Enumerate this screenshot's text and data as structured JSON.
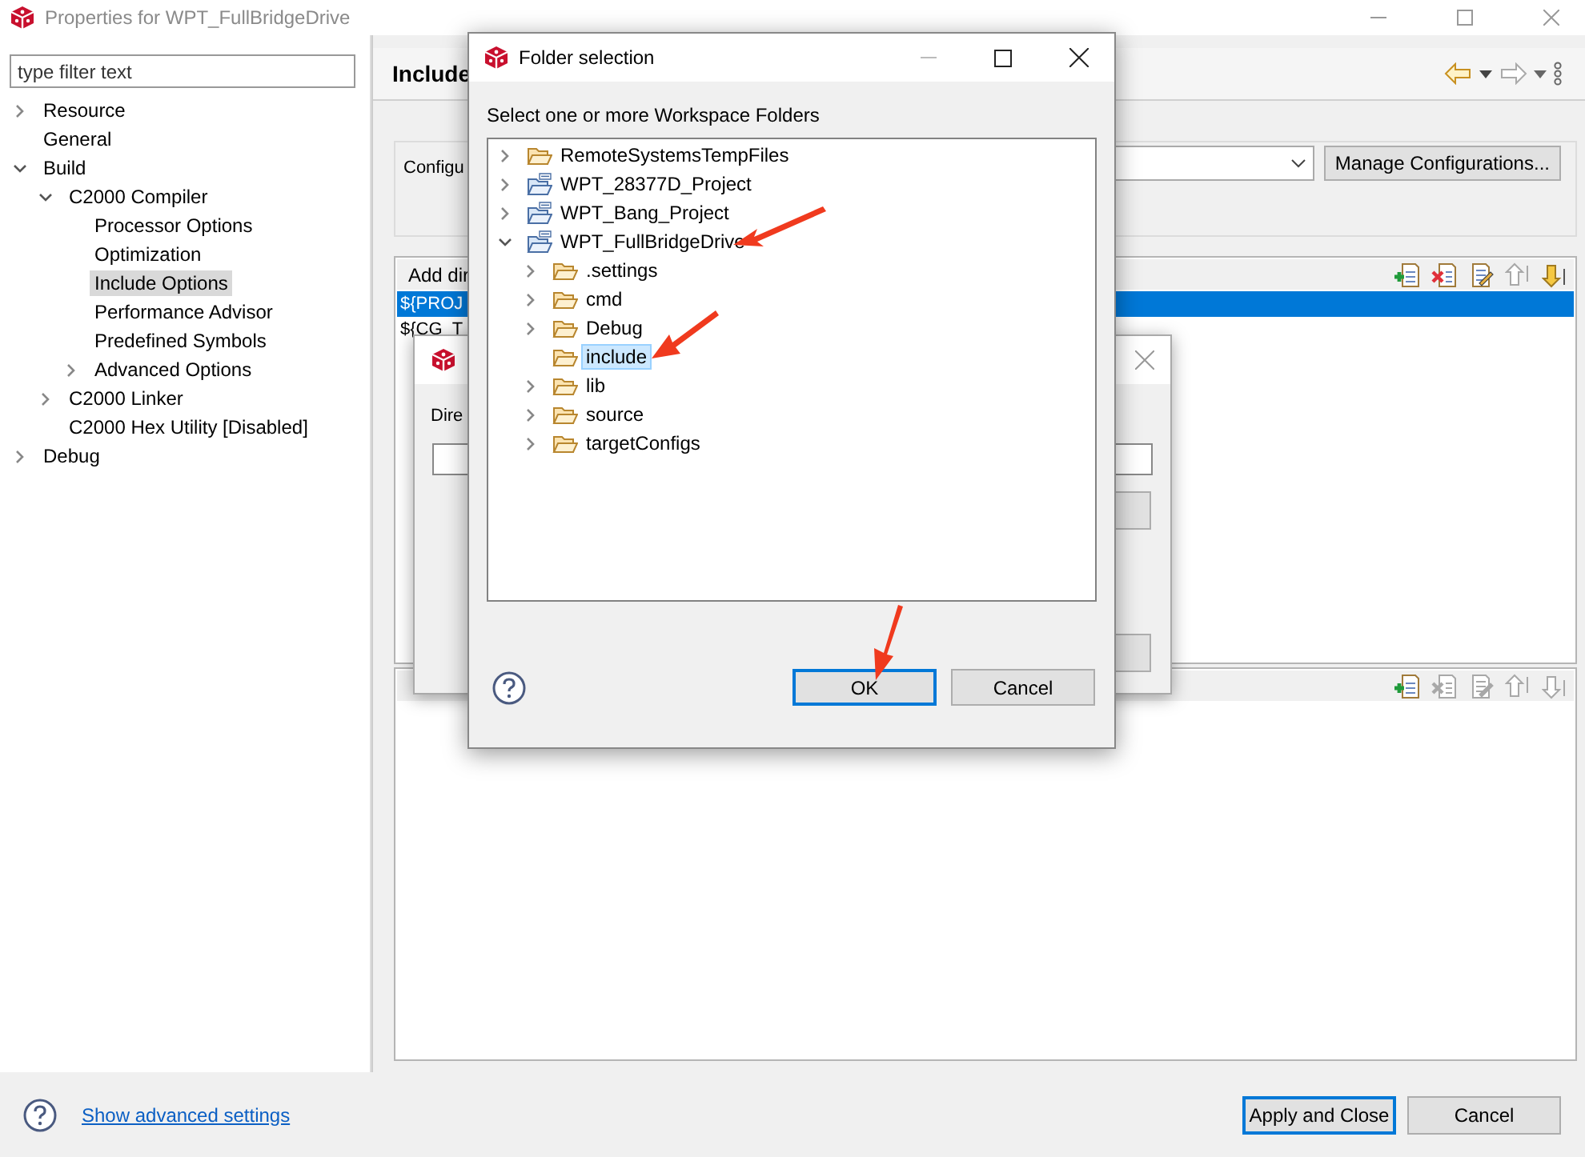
{
  "window": {
    "title": "Properties for WPT_FullBridgeDrive"
  },
  "sidebar": {
    "filter": {
      "placeholder": "type filter text"
    },
    "tree": [
      {
        "label": "Resource",
        "expanded": false,
        "selected": false
      },
      {
        "label": "General",
        "selected": false
      },
      {
        "label": "Build",
        "expanded": true,
        "selected": false,
        "children": [
          {
            "label": "C2000 Compiler",
            "expanded": true,
            "selected": false,
            "children": [
              {
                "label": "Processor Options",
                "selected": false
              },
              {
                "label": "Optimization",
                "selected": false
              },
              {
                "label": "Include Options",
                "selected": true
              },
              {
                "label": "Performance Advisor",
                "selected": false
              },
              {
                "label": "Predefined Symbols",
                "selected": false
              },
              {
                "label": "Advanced Options",
                "expanded": false,
                "selected": false
              }
            ]
          },
          {
            "label": "C2000 Linker",
            "expanded": false,
            "selected": false
          },
          {
            "label": "C2000 Hex Utility  [Disabled]",
            "selected": false
          }
        ]
      },
      {
        "label": "Debug",
        "expanded": false,
        "selected": false
      }
    ]
  },
  "page": {
    "title": "Include",
    "config_label": "Configu",
    "manage_button": "Manage Configurations...",
    "include_list": {
      "header": "Add dir",
      "tools": [
        {
          "kind": "add",
          "disabled": false
        },
        {
          "kind": "delete",
          "disabled": false
        },
        {
          "kind": "edit",
          "disabled": false
        },
        {
          "kind": "up",
          "disabled": true
        },
        {
          "kind": "down",
          "disabled": false
        }
      ],
      "rows": [
        {
          "text": "${PROJ",
          "selected": true
        },
        {
          "text": "${CG_T",
          "selected": false
        }
      ]
    },
    "search_list": {
      "tools": [
        {
          "kind": "add",
          "disabled": false
        },
        {
          "kind": "delete",
          "disabled": true
        },
        {
          "kind": "edit",
          "disabled": true
        },
        {
          "kind": "up",
          "disabled": true
        },
        {
          "kind": "down",
          "disabled": true
        }
      ]
    }
  },
  "back_dialog": {
    "label": "Dire"
  },
  "folder_dialog": {
    "title": "Folder selection",
    "prompt": "Select one or more Workspace Folders",
    "tree": [
      {
        "label": "RemoteSystemsTempFiles",
        "kind": "folder",
        "expanded": false,
        "selected": false
      },
      {
        "label": "WPT_28377D_Project",
        "kind": "project",
        "expanded": false,
        "selected": false
      },
      {
        "label": "WPT_Bang_Project",
        "kind": "project",
        "expanded": false,
        "selected": false
      },
      {
        "label": "WPT_FullBridgeDrive",
        "kind": "project",
        "expanded": true,
        "selected": false,
        "children": [
          {
            "label": ".settings",
            "kind": "folder",
            "expanded": false,
            "selected": false
          },
          {
            "label": "cmd",
            "kind": "folder",
            "expanded": false,
            "selected": false
          },
          {
            "label": "Debug",
            "kind": "folder",
            "expanded": false,
            "selected": false
          },
          {
            "label": "include",
            "kind": "folder",
            "selected": true
          },
          {
            "label": "lib",
            "kind": "folder",
            "expanded": false,
            "selected": false
          },
          {
            "label": "source",
            "kind": "folder",
            "expanded": false,
            "selected": false
          },
          {
            "label": "targetConfigs",
            "kind": "folder",
            "expanded": false,
            "selected": false
          }
        ]
      }
    ],
    "ok_button": "OK",
    "cancel_button": "Cancel"
  },
  "footer": {
    "link": "Show advanced settings",
    "apply_button": "Apply and Close",
    "cancel_button": "Cancel"
  }
}
